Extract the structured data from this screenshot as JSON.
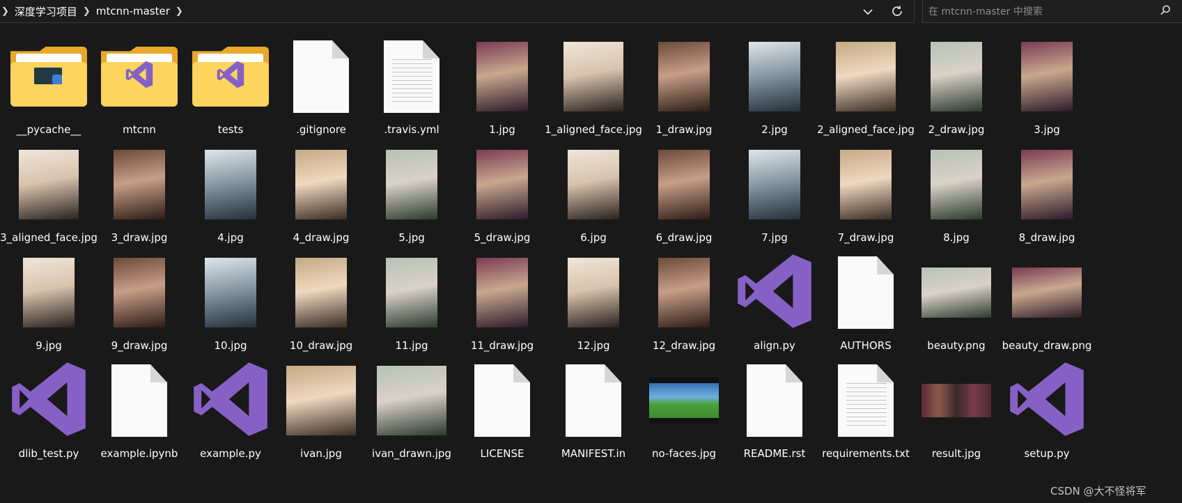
{
  "breadcrumb": {
    "items": [
      "深度学习项目",
      "mtcnn-master"
    ]
  },
  "search": {
    "placeholder": "在 mtcnn-master 中搜索"
  },
  "watermark": "CSDN @大不怪将军",
  "colors": {
    "background": "#191919",
    "folder": "#fcd45e",
    "vs_purple": "#8661c5",
    "text": "#ffffff"
  },
  "icons": {
    "dropdown": "chevron-down-icon",
    "refresh": "refresh-icon",
    "search": "search-icon"
  },
  "files": [
    {
      "name": "__pycache__",
      "type": "folder-code"
    },
    {
      "name": "mtcnn",
      "type": "folder-vs"
    },
    {
      "name": "tests",
      "type": "folder-vs"
    },
    {
      "name": ".gitignore",
      "type": "doc"
    },
    {
      "name": ".travis.yml",
      "type": "doc-lines"
    },
    {
      "name": "1.jpg",
      "type": "photo"
    },
    {
      "name": "1_aligned_face.jpg",
      "type": "photo"
    },
    {
      "name": "1_draw.jpg",
      "type": "photo"
    },
    {
      "name": "2.jpg",
      "type": "photo"
    },
    {
      "name": "2_aligned_face.jpg",
      "type": "photo"
    },
    {
      "name": "2_draw.jpg",
      "type": "photo"
    },
    {
      "name": "3.jpg",
      "type": "photo"
    },
    {
      "name": "3_aligned_face.jpg",
      "type": "photo"
    },
    {
      "name": "3_draw.jpg",
      "type": "photo"
    },
    {
      "name": "4.jpg",
      "type": "photo"
    },
    {
      "name": "4_draw.jpg",
      "type": "photo"
    },
    {
      "name": "5.jpg",
      "type": "photo"
    },
    {
      "name": "5_draw.jpg",
      "type": "photo"
    },
    {
      "name": "6.jpg",
      "type": "photo"
    },
    {
      "name": "6_draw.jpg",
      "type": "photo"
    },
    {
      "name": "7.jpg",
      "type": "photo"
    },
    {
      "name": "7_draw.jpg",
      "type": "photo"
    },
    {
      "name": "8.jpg",
      "type": "photo"
    },
    {
      "name": "8_draw.jpg",
      "type": "photo"
    },
    {
      "name": "9.jpg",
      "type": "photo"
    },
    {
      "name": "9_draw.jpg",
      "type": "photo"
    },
    {
      "name": "10.jpg",
      "type": "photo"
    },
    {
      "name": "10_draw.jpg",
      "type": "photo"
    },
    {
      "name": "11.jpg",
      "type": "photo"
    },
    {
      "name": "11_draw.jpg",
      "type": "photo"
    },
    {
      "name": "12.jpg",
      "type": "photo"
    },
    {
      "name": "12_draw.jpg",
      "type": "photo"
    },
    {
      "name": "align.py",
      "type": "vs"
    },
    {
      "name": "AUTHORS",
      "type": "doc"
    },
    {
      "name": "beauty.png",
      "type": "photo-wide"
    },
    {
      "name": "beauty_draw.png",
      "type": "photo-wide"
    },
    {
      "name": "dlib_test.py",
      "type": "vs"
    },
    {
      "name": "example.ipynb",
      "type": "doc"
    },
    {
      "name": "example.py",
      "type": "vs"
    },
    {
      "name": "ivan.jpg",
      "type": "photo-wide"
    },
    {
      "name": "ivan_drawn.jpg",
      "type": "photo-wide"
    },
    {
      "name": "LICENSE",
      "type": "doc"
    },
    {
      "name": "MANIFEST.in",
      "type": "doc"
    },
    {
      "name": "no-faces.jpg",
      "type": "cartoon"
    },
    {
      "name": "README.rst",
      "type": "doc"
    },
    {
      "name": "requirements.txt",
      "type": "doc-lines"
    },
    {
      "name": "result.jpg",
      "type": "photo-strip"
    },
    {
      "name": "setup.py",
      "type": "vs"
    }
  ]
}
